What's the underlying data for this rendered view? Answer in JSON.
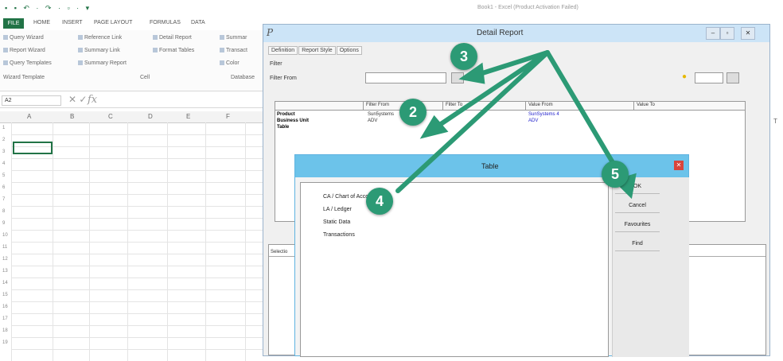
{
  "excel": {
    "quick_access": "▪ ▪ ↶ · ↷ · ▫ · ▾",
    "doc_title": "Book1 - Excel (Product Activation Failed)",
    "tabs": [
      "FILE",
      "HOME",
      "INSERT",
      "PAGE LAYOUT",
      "FORMULAS",
      "DATA"
    ],
    "ribbon": {
      "wizard": [
        "Query Wizard",
        "Report Wizard",
        "Query Templates"
      ],
      "wizard_group": "Wizard   Template",
      "cell_a": [
        "Reference Link",
        "Summary Link",
        "Summary Report"
      ],
      "cell_b": [
        "Detail Report",
        "Format Tables"
      ],
      "cell_group": "Cell",
      "db": [
        "Summar",
        "Transact",
        "Color"
      ],
      "db_group": "Database"
    },
    "name_box": "A2",
    "fx": "fx",
    "columns": [
      "A",
      "B",
      "C",
      "D",
      "E",
      "F"
    ],
    "rows": [
      "1",
      "2",
      "3",
      "4",
      "5",
      "6",
      "7",
      "8",
      "9",
      "10",
      "11",
      "12",
      "13",
      "14",
      "15",
      "16",
      "17",
      "18",
      "19"
    ]
  },
  "detail_report": {
    "title": "Detail Report",
    "icon": "P",
    "controls": [
      "–",
      "▫",
      "✕"
    ],
    "tabs": [
      "Definition",
      "Report Style",
      "Options"
    ],
    "filter_group": "Filter",
    "filter_from_label": "Filter From",
    "table": {
      "headers": [
        "Filter From",
        "Filter To",
        "Value From",
        "Value To"
      ],
      "rows": [
        {
          "label": "Product",
          "filter_from": "Sun5ystems",
          "value_from": "SunSystems 4"
        },
        {
          "label": "Business Unit",
          "filter_from": "ADV",
          "value_from": "ADV"
        },
        {
          "label": "Table",
          "filter_from": "",
          "value_from": ""
        }
      ]
    },
    "selection_label": "Selectio"
  },
  "table_dialog": {
    "title": "Table",
    "close": "✕",
    "items": [
      "CA  /  Chart of Accounts",
      "LA  /  Ledger",
      "Static Data",
      "Transactions"
    ],
    "buttons": [
      "OK",
      "Cancel",
      "Favourites",
      "Find"
    ]
  },
  "badges": [
    "2",
    "3",
    "4",
    "5"
  ],
  "colors": {
    "excel_green": "#217346",
    "badge_green": "#2c9a75",
    "dialog_title": "#6cc3ea",
    "detail_title": "#cce4f7"
  },
  "right_edge_letter": "T"
}
